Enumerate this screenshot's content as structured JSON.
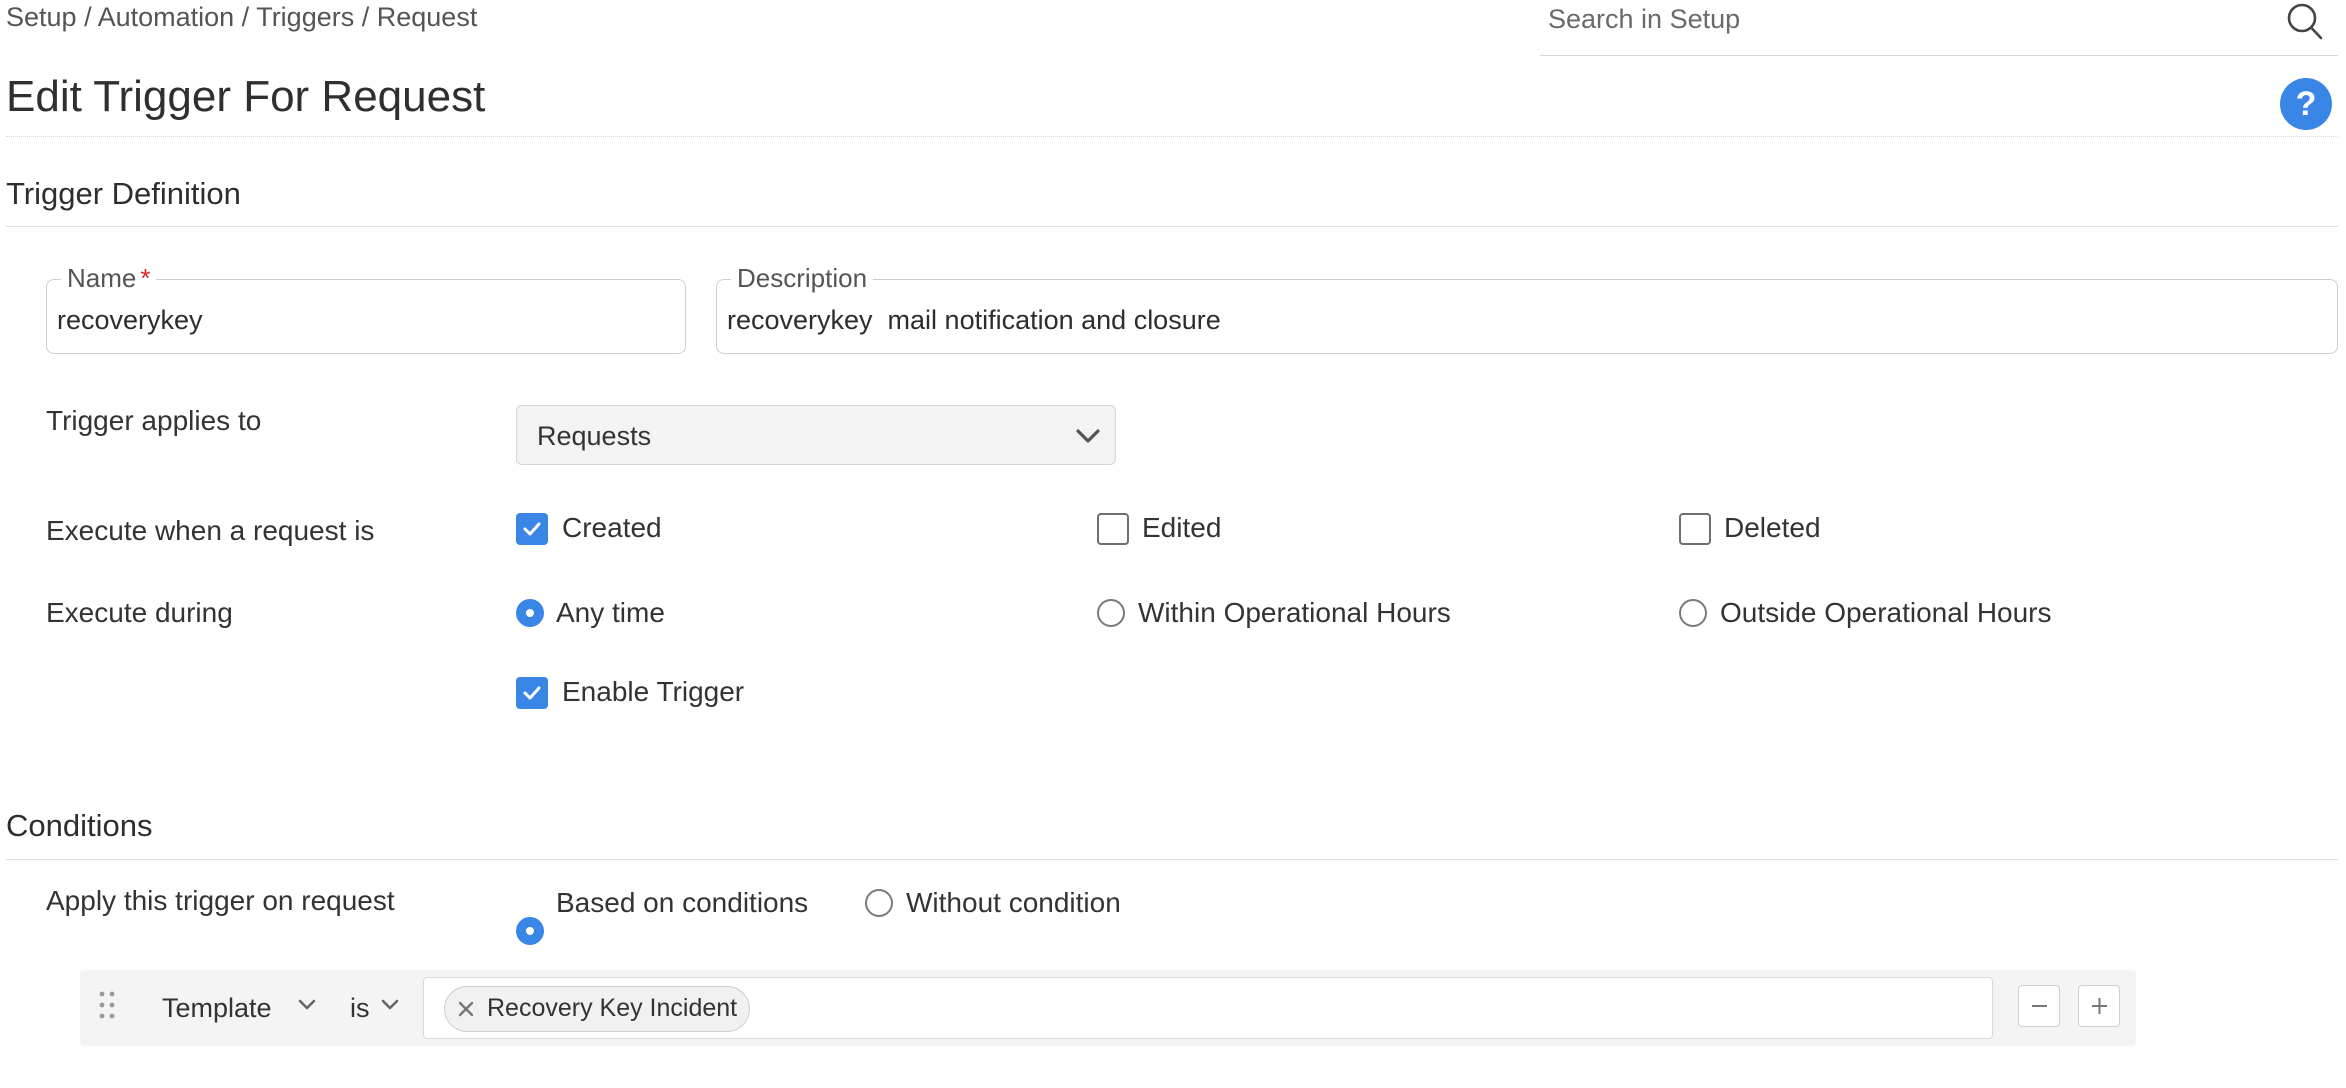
{
  "breadcrumb": {
    "items": [
      "Setup",
      "Automation",
      "Triggers",
      "Request"
    ],
    "separator": " / ",
    "text": "Setup / Automation / Triggers / Request"
  },
  "search": {
    "placeholder": "Search in Setup",
    "icon": "search-icon"
  },
  "page_title": "Edit Trigger For Request",
  "help": {
    "label": "?",
    "icon": "help-icon"
  },
  "trigger_definition": {
    "title": "Trigger Definition",
    "name_field": {
      "label": "Name",
      "required_mark": "*",
      "value": "recoverykey"
    },
    "description_field": {
      "label": "Description",
      "value": "recoverykey  mail notification and closure"
    },
    "applies_to": {
      "label": "Trigger applies to",
      "selected": "Requests"
    },
    "execute_when": {
      "label": "Execute when a request is",
      "options": [
        {
          "label": "Created",
          "checked": true
        },
        {
          "label": "Edited",
          "checked": false
        },
        {
          "label": "Deleted",
          "checked": false
        }
      ]
    },
    "execute_during": {
      "label": "Execute during",
      "options": [
        {
          "label": "Any time",
          "selected": true
        },
        {
          "label": "Within Operational Hours",
          "selected": false
        },
        {
          "label": "Outside Operational Hours",
          "selected": false
        }
      ]
    },
    "enable_trigger": {
      "label": "Enable Trigger",
      "checked": true
    }
  },
  "conditions": {
    "title": "Conditions",
    "apply_label": "Apply this trigger on request",
    "apply_options": [
      {
        "label": "Based on conditions",
        "selected": true
      },
      {
        "label": "Without condition",
        "selected": false
      }
    ],
    "rows": [
      {
        "field": "Template",
        "operator": "is",
        "values": [
          "Recovery Key Incident"
        ],
        "remove_icon": "minus-icon",
        "add_icon": "plus-icon"
      }
    ]
  },
  "colors": {
    "accent": "#3a86e6",
    "text": "#333333",
    "required": "#e02424",
    "row_bg": "#f4f4f4"
  }
}
